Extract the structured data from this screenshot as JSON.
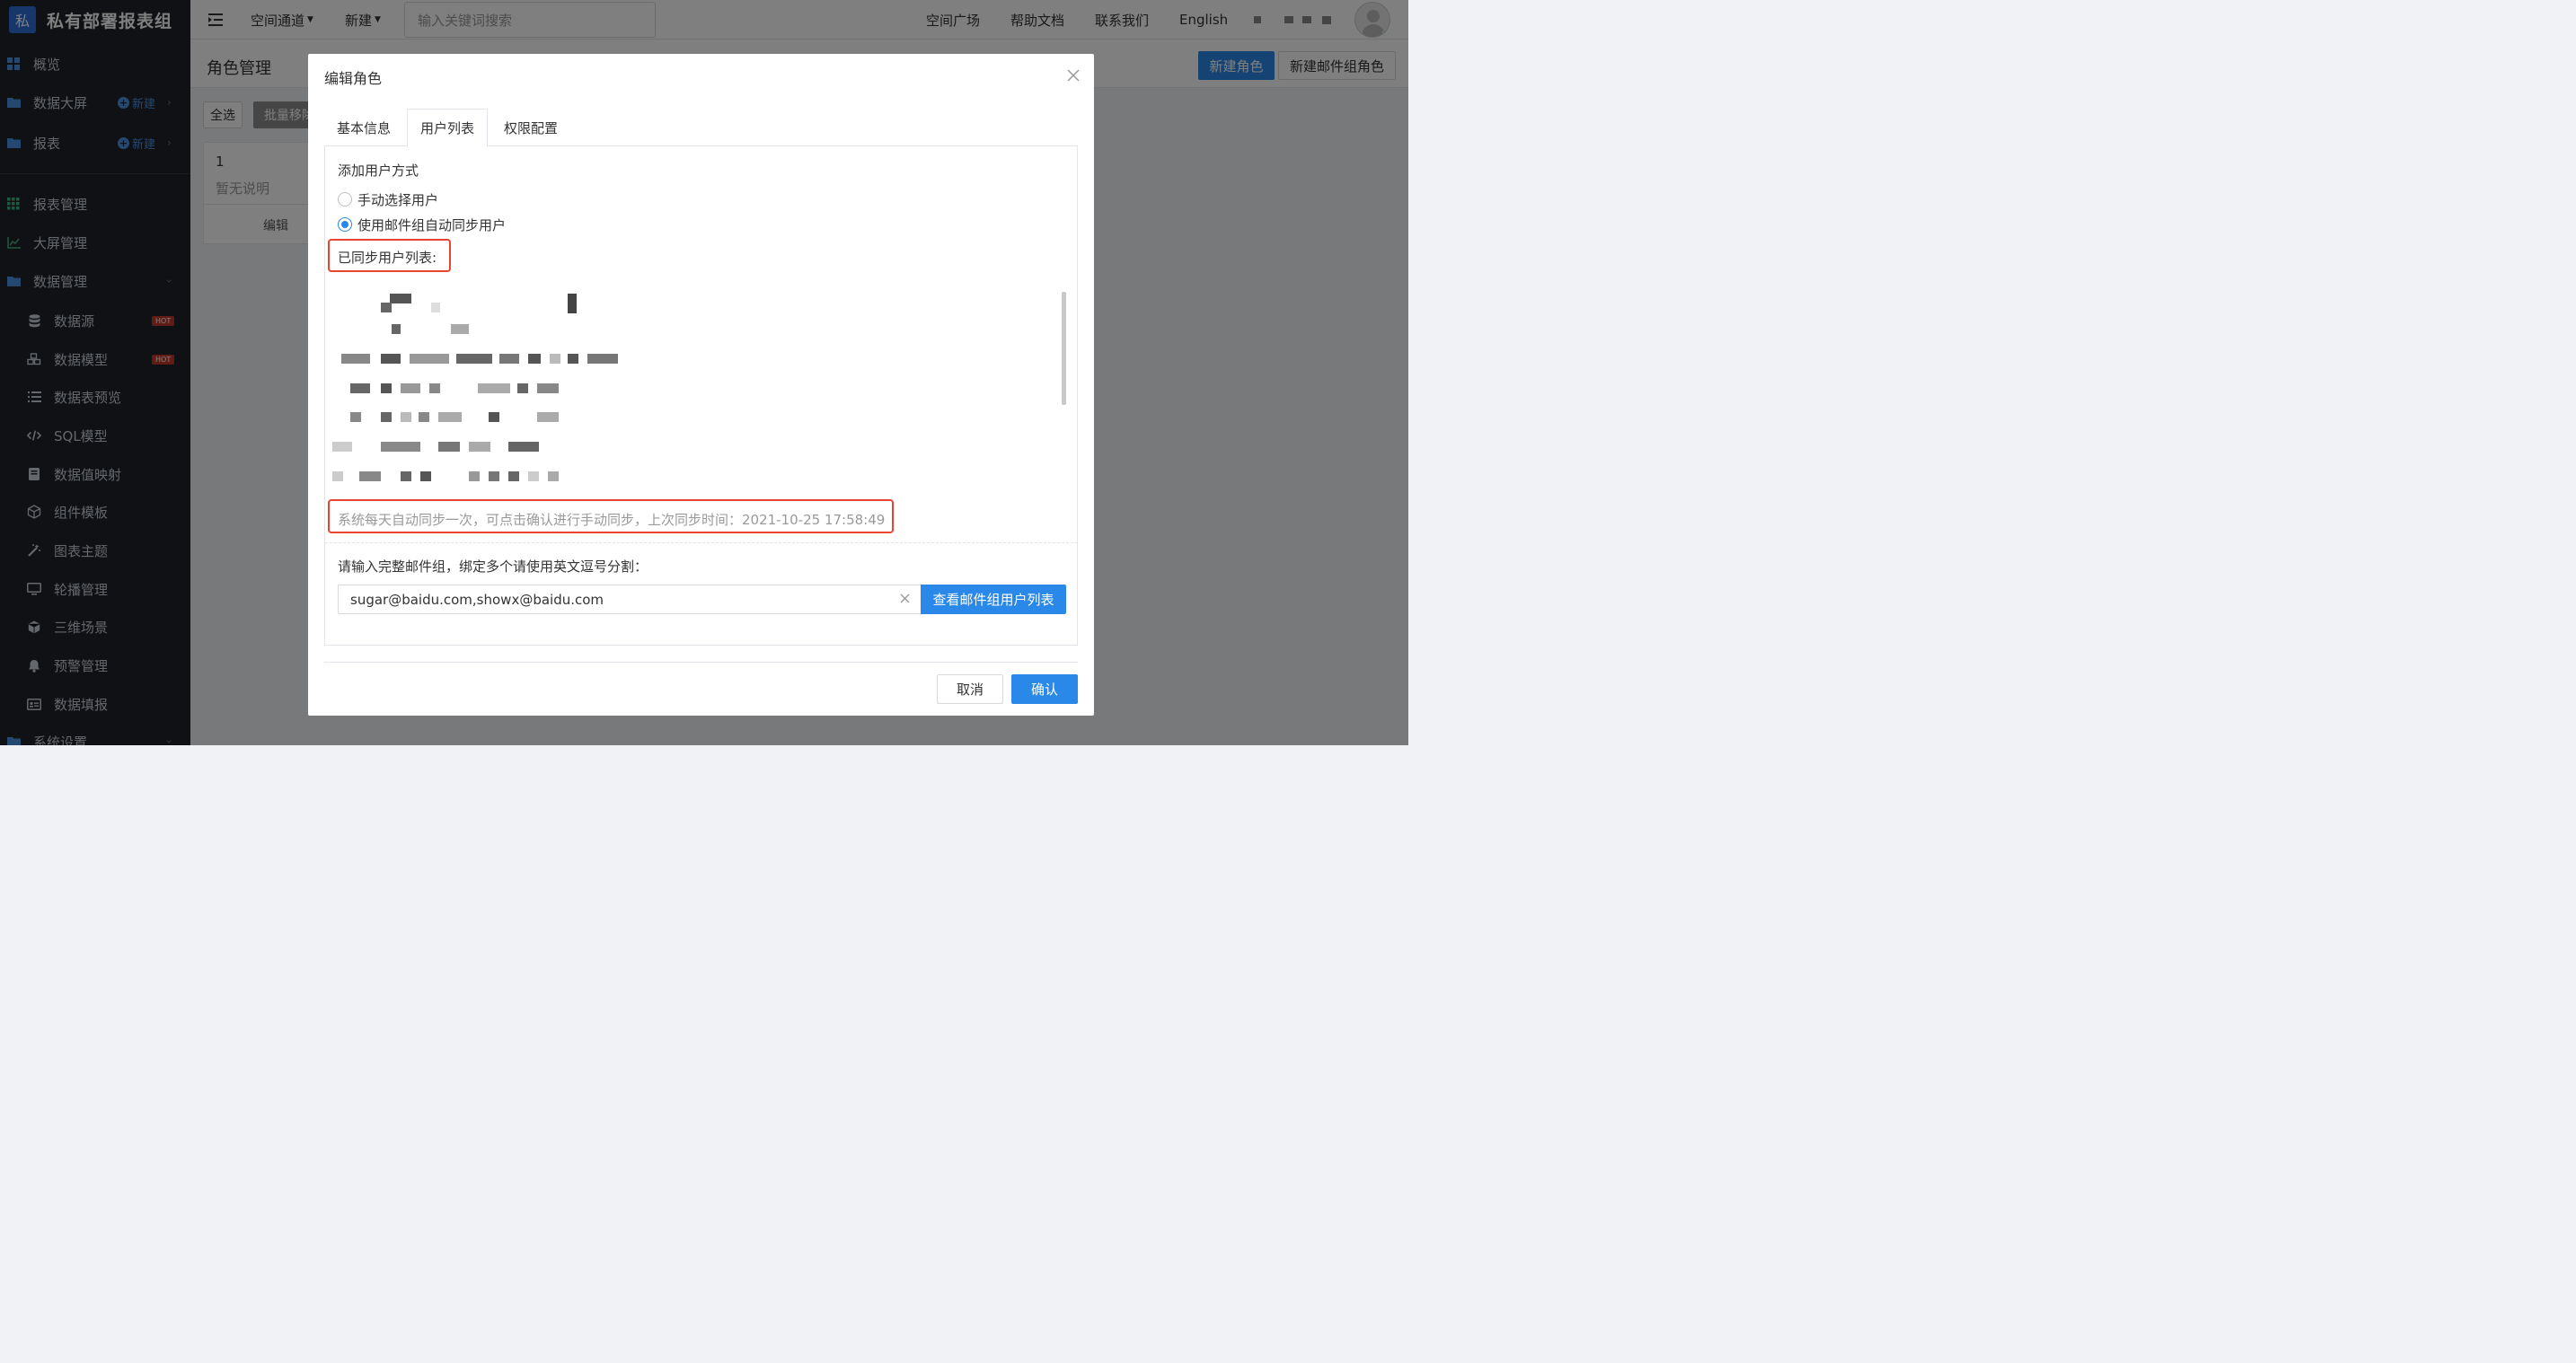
{
  "brand": {
    "logo_char": "私",
    "name": "私有部署报表组"
  },
  "sidebar": {
    "items": [
      {
        "label": "概览",
        "icon": "grid-icon"
      },
      {
        "label": "数据大屏",
        "icon": "folder-icon",
        "new_label": "新建"
      },
      {
        "label": "报表",
        "icon": "folder-icon",
        "new_label": "新建"
      },
      {
        "label": "报表管理",
        "icon": "apps-icon"
      },
      {
        "label": "大屏管理",
        "icon": "chart-line-icon"
      },
      {
        "label": "数据管理",
        "icon": "folder-icon"
      }
    ],
    "sub_items": [
      {
        "label": "数据源",
        "icon": "database-icon",
        "badge": "HOT"
      },
      {
        "label": "数据模型",
        "icon": "cubes-icon",
        "badge": "HOT"
      },
      {
        "label": "数据表预览",
        "icon": "list-icon"
      },
      {
        "label": "SQL模型",
        "icon": "code-icon"
      },
      {
        "label": "数据值映射",
        "icon": "book-icon"
      },
      {
        "label": "组件模板",
        "icon": "cube-outline-icon"
      },
      {
        "label": "图表主题",
        "icon": "magic-wand-icon"
      },
      {
        "label": "轮播管理",
        "icon": "monitor-icon"
      },
      {
        "label": "三维场景",
        "icon": "box-3d-icon"
      },
      {
        "label": "预警管理",
        "icon": "bell-icon"
      },
      {
        "label": "数据填报",
        "icon": "id-card-icon"
      }
    ],
    "bottom_item": {
      "label": "系统设置",
      "icon": "folder-icon"
    }
  },
  "topbar": {
    "space_channel": "空间通道",
    "new": "新建",
    "search_placeholder": "输入关键词搜索",
    "space_square": "空间广场",
    "help_docs": "帮助文档",
    "contact_us": "联系我们",
    "language": "English"
  },
  "page": {
    "title": "角色管理",
    "new_role": "新建角色",
    "new_mail_group_role": "新建邮件组角色",
    "select_all": "全选",
    "batch_remove": "批量移除",
    "card": {
      "name": "1",
      "desc": "暂无说明",
      "edit": "编辑"
    }
  },
  "modal": {
    "title": "编辑角色",
    "tabs": [
      "基本信息",
      "用户列表",
      "权限配置"
    ],
    "active_tab": "用户列表",
    "add_user_method_label": "添加用户方式",
    "options": [
      {
        "label": "手动选择用户",
        "checked": false
      },
      {
        "label": "使用邮件组自动同步用户",
        "checked": true
      }
    ],
    "synced_list_label": "已同步用户列表:",
    "sync_note": "系统每天自动同步一次，可点击确认进行手动同步，上次同步时间：2021-10-25 17:58:49",
    "email_group_label": "请输入完整邮件组，绑定多个请使用英文逗号分割：",
    "email_value": "sugar@baidu.com,showx@baidu.com",
    "view_members_button": "查看邮件组用户列表",
    "cancel": "取消",
    "confirm": "确认"
  },
  "colors": {
    "accent": "#2a88e8",
    "highlight": "#e8442e",
    "sidebar_bg": "#1f2329"
  }
}
